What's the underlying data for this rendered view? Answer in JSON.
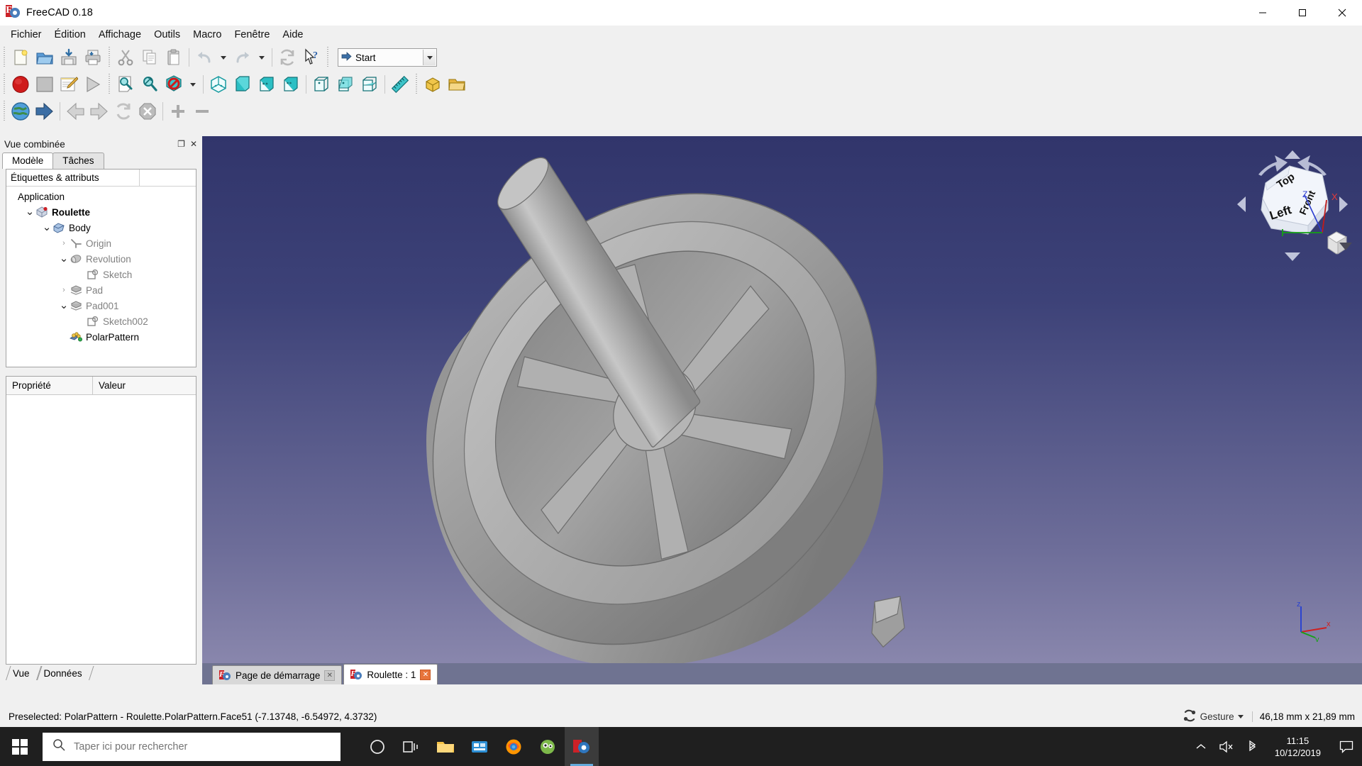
{
  "window": {
    "title": "FreeCAD 0.18",
    "app_icon": "freecad-logo-icon",
    "minimize": "—",
    "maximize": "❐",
    "close": "✕"
  },
  "menubar": {
    "items": [
      {
        "label": "Fichier",
        "name": "menu-fichier"
      },
      {
        "label": "Édition",
        "name": "menu-edition"
      },
      {
        "label": "Affichage",
        "name": "menu-affichage"
      },
      {
        "label": "Outils",
        "name": "menu-outils"
      },
      {
        "label": "Macro",
        "name": "menu-macro"
      },
      {
        "label": "Fenêtre",
        "name": "menu-fenetre"
      },
      {
        "label": "Aide",
        "name": "menu-aide"
      }
    ]
  },
  "toolbars": {
    "file": [
      "new-document-icon",
      "open-document-icon",
      "save-document-icon",
      "print-document-icon"
    ],
    "edit": [
      "cut-icon",
      "copy-icon",
      "paste-icon",
      "undo-icon",
      "undo-dropdown-icon",
      "redo-icon",
      "redo-dropdown-icon",
      "refresh-icon",
      "whats-this-icon"
    ],
    "workbench": {
      "value": "Start",
      "label": "Start"
    },
    "macro": [
      "macro-record-icon",
      "macro-stop-icon",
      "macro-edit-icon",
      "macro-execute-icon"
    ],
    "view": [
      "fit-all-icon",
      "fit-selection-icon",
      "draw-style-icon",
      "draw-style-dropdown-icon",
      "isometric-view-icon",
      "front-view-icon",
      "top-view-icon",
      "right-view-icon",
      "rear-view-icon",
      "bottom-view-icon",
      "left-view-icon",
      "measure-icon"
    ],
    "structure": [
      "create-part-icon",
      "create-group-icon"
    ],
    "navigation": [
      "web-home-icon",
      "link-go-icon",
      "back-icon",
      "forward-icon",
      "refresh-web-icon",
      "stop-loading-icon",
      "zoom-in-icon",
      "zoom-out-icon"
    ]
  },
  "combo_view": {
    "title": "Vue combinée",
    "float_button": "❐",
    "close_button": "✕",
    "tabs": [
      {
        "label": "Modèle",
        "active": true
      },
      {
        "label": "Tâches",
        "active": false
      }
    ],
    "tree_header": "Étiquettes & attributs",
    "tree": [
      {
        "label": "Application",
        "depth": 0,
        "twist": "",
        "icon": "",
        "style": "dark"
      },
      {
        "label": "Roulette",
        "depth": 1,
        "twist": "⌄",
        "icon": "document-icon",
        "style": "doc"
      },
      {
        "label": "Body",
        "depth": 2,
        "twist": "⌄",
        "icon": "body-icon",
        "style": "dark"
      },
      {
        "label": "Origin",
        "depth": 3,
        "twist": "›",
        "icon": "origin-icon",
        "style": "gray"
      },
      {
        "label": "Revolution",
        "depth": 3,
        "twist": "⌄",
        "icon": "revolution-icon",
        "style": "gray"
      },
      {
        "label": "Sketch",
        "depth": 4,
        "twist": "",
        "icon": "sketch-icon",
        "style": "gray"
      },
      {
        "label": "Pad",
        "depth": 3,
        "twist": "›",
        "icon": "pad-icon",
        "style": "gray"
      },
      {
        "label": "Pad001",
        "depth": 3,
        "twist": "⌄",
        "icon": "pad-icon",
        "style": "gray"
      },
      {
        "label": "Sketch002",
        "depth": 4,
        "twist": "",
        "icon": "sketch-icon",
        "style": "gray"
      },
      {
        "label": "PolarPattern",
        "depth": 3,
        "twist": "",
        "icon": "polar-pattern-icon",
        "style": "dark"
      }
    ],
    "property_columns": {
      "name": "Propriété",
      "value": "Valeur"
    },
    "property_rows": [],
    "bottom_tabs": [
      {
        "label": "Vue"
      },
      {
        "label": "Données"
      }
    ]
  },
  "viewport": {
    "document_tabs": [
      {
        "label": "Page de démarrage",
        "active": false,
        "close": "✕"
      },
      {
        "label": "Roulette : 1",
        "active": true,
        "close": "✕"
      }
    ],
    "nav_cube": {
      "faces": [
        "Top",
        "Front",
        "Left"
      ],
      "axes": [
        "X",
        "Z"
      ]
    },
    "axis_labels": {
      "x": "x",
      "y": "y",
      "z": "z"
    }
  },
  "statusbar": {
    "message": "Preselected: PolarPattern - Roulette.PolarPattern.Face51 (-7.13748, -6.54972, 4.3732)",
    "nav_style": "Gesture",
    "nav_icon": "gesture-icon",
    "dimensions": "46,18 mm x 21,89 mm"
  },
  "taskbar": {
    "start_icon": "windows-start-icon",
    "search_placeholder": "Taper ici pour rechercher",
    "search_value": "",
    "apps": [
      {
        "name": "cortana-icon"
      },
      {
        "name": "task-view-icon"
      },
      {
        "name": "file-explorer-icon"
      },
      {
        "name": "store-icon"
      },
      {
        "name": "firefox-icon"
      },
      {
        "name": "unknown-app-icon"
      },
      {
        "name": "freecad-icon",
        "active": true
      }
    ],
    "tray": [
      "show-hidden-icons-icon",
      "volume-muted-icon",
      "bluetooth-icon"
    ],
    "clock": {
      "time": "11:15",
      "date": "10/12/2019"
    },
    "notification_icon": "action-center-icon"
  },
  "colors": {
    "accent": "#cc2127",
    "toolbar_cyan": "#2bbfc4",
    "viewport_top": "#31356b",
    "viewport_bottom": "#8e8bb0",
    "model_gray": "#a0a0a0"
  }
}
